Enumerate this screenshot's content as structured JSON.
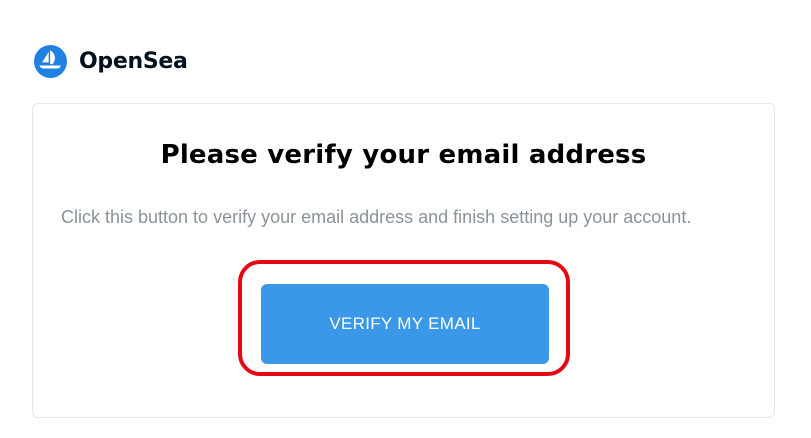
{
  "brand": {
    "name": "OpenSea",
    "logo_icon": "opensea-sailboat-icon",
    "logo_color": "#2081e2"
  },
  "card": {
    "title": "Please verify your email address",
    "body": "Click this button to verify your email address and finish setting up your account.",
    "button_label": "VERIFY MY EMAIL"
  },
  "colors": {
    "button": "#3b97e8",
    "highlight": "#e50914",
    "body_text": "#8a939b"
  }
}
